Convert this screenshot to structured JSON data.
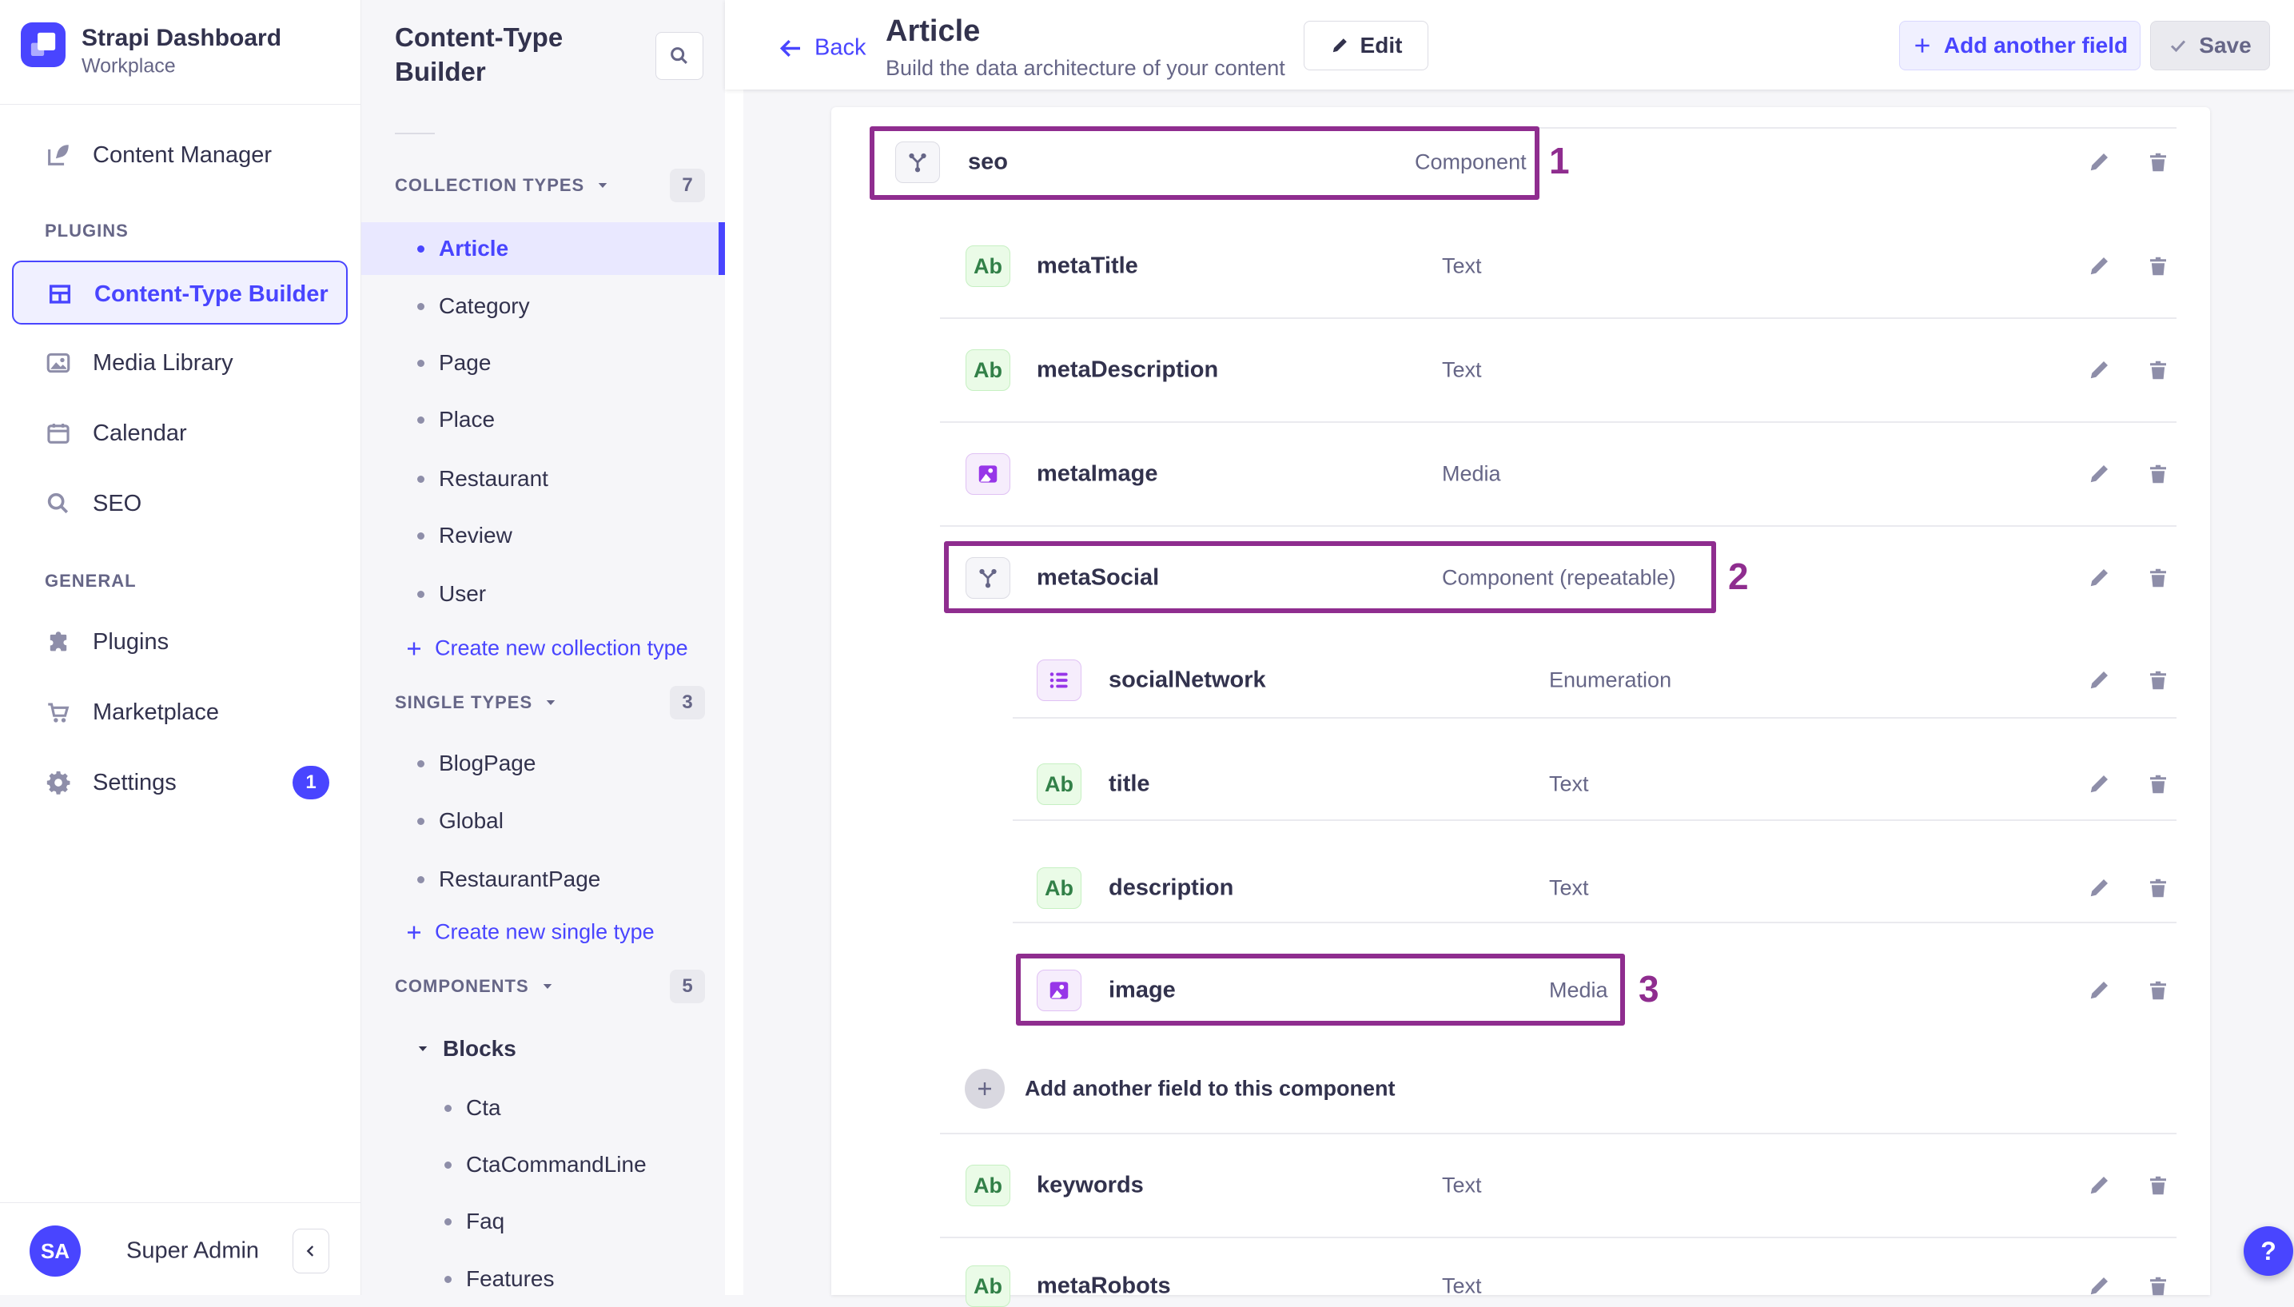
{
  "app": {
    "title": "Strapi Dashboard",
    "workspace": "Workplace",
    "user": {
      "initials": "SA",
      "name": "Super Admin"
    },
    "help_label": "?"
  },
  "sidebar": {
    "content_manager": "Content Manager",
    "sections": {
      "plugins": "PLUGINS",
      "general": "GENERAL"
    },
    "content_type_builder": "Content-Type Builder",
    "media_library": "Media Library",
    "calendar": "Calendar",
    "seo": "SEO",
    "plugins": "Plugins",
    "marketplace": "Marketplace",
    "settings": "Settings",
    "settings_badge": "1"
  },
  "builder_panel": {
    "title": "Content-Type Builder",
    "collection_types": {
      "label": "COLLECTION TYPES",
      "count": "7",
      "items": [
        "Article",
        "Category",
        "Page",
        "Place",
        "Restaurant",
        "Review",
        "User"
      ],
      "create": "Create new collection type"
    },
    "single_types": {
      "label": "SINGLE TYPES",
      "count": "3",
      "items": [
        "BlogPage",
        "Global",
        "RestaurantPage"
      ],
      "create": "Create new single type"
    },
    "components": {
      "label": "COMPONENTS",
      "count": "5",
      "group": "Blocks",
      "items": [
        "Cta",
        "CtaCommandLine",
        "Faq",
        "Features"
      ]
    }
  },
  "header": {
    "back": "Back",
    "title": "Article",
    "subtitle": "Build the data architecture of your content",
    "edit": "Edit",
    "add_field": "Add another field",
    "save": "Save"
  },
  "table": {
    "field_badge_text": "Ab",
    "rows": [
      {
        "name": "seo",
        "type": "Component",
        "annotation": "1"
      },
      {
        "name": "metaTitle",
        "type": "Text"
      },
      {
        "name": "metaDescription",
        "type": "Text"
      },
      {
        "name": "metaImage",
        "type": "Media"
      },
      {
        "name": "metaSocial",
        "type": "Component (repeatable)",
        "annotation": "2"
      },
      {
        "name": "socialNetwork",
        "type": "Enumeration"
      },
      {
        "name": "title",
        "type": "Text"
      },
      {
        "name": "description",
        "type": "Text"
      },
      {
        "name": "image",
        "type": "Media",
        "annotation": "3"
      },
      {
        "name": "keywords",
        "type": "Text"
      },
      {
        "name": "metaRobots",
        "type": "Text"
      }
    ],
    "add_field_in_component": "Add another field to this component"
  },
  "icons": {
    "search": "magnifier",
    "edit": "pencil",
    "delete": "trash",
    "add": "plus",
    "save": "check",
    "back": "arrow-left",
    "component_field": "branch-nodes",
    "text_field": "Ab",
    "media_field": "picture",
    "enumeration_field": "bullet-list",
    "help": "question-mark"
  },
  "colors": {
    "accent": "#4945ff",
    "accent_bg": "#f0f0ff",
    "annotation": "#8f2d8f",
    "text_dark": "#32324d",
    "text_gray": "#666687",
    "badge_green_text": "#328048",
    "badge_green_bg": "#eafbe7",
    "badge_purple_glyph": "#9736e8",
    "badge_purple_bg": "#f6edfc"
  }
}
